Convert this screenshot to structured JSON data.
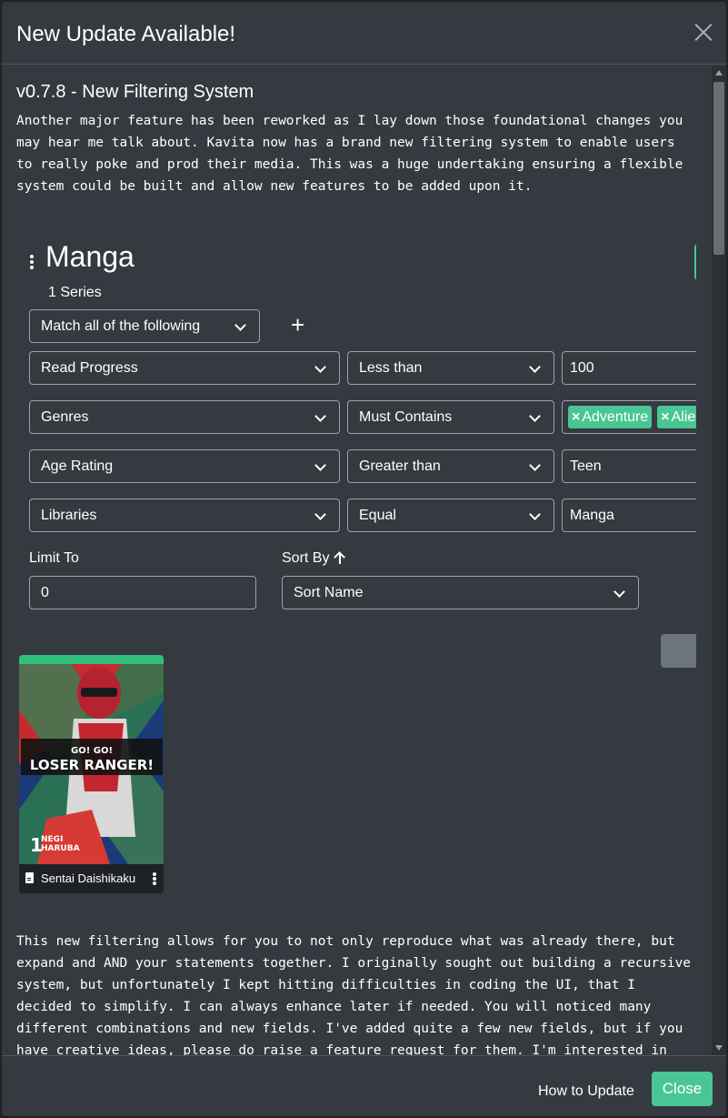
{
  "modal": {
    "title": "New Update Available!",
    "release_title": "v0.7.8 - New Filtering System",
    "intro_text": "Another major feature has been reworked as I lay down those foundational changes you\nmay hear me talk about. Kavita now has a brand new filtering system to enable users\nto really poke and prod their media. This was a huge undertaking ensuring a flexible\nsystem could be built and allow new features to be added upon it.",
    "body_text": "This new filtering allows for you to not only reproduce what was already there, but\nexpand and AND your statements together. I originally sought out building a recursive\nsystem, but unfortunately I kept hitting difficulties in coding the UI, that I\ndecided to simplify. I can always enhance later if needed. You will noticed many\ndifferent combinations and new fields. I've added quite a few new fields, but if you\nhave creative ideas, please do raise a feature request for them. I'm interested in"
  },
  "screenshot": {
    "library_title": "Manga",
    "series_count": "1 Series",
    "match_mode": "Match all of the following",
    "filter_rows": [
      {
        "field": "Read Progress",
        "comparison": "Less than",
        "value": "100"
      },
      {
        "field": "Genres",
        "comparison": "Must Contains",
        "chips": [
          "Adventure",
          "Alie"
        ]
      },
      {
        "field": "Age Rating",
        "comparison": "Greater than",
        "value": "Teen"
      },
      {
        "field": "Libraries",
        "comparison": "Equal",
        "value": "Manga"
      }
    ],
    "limit_to_label": "Limit To",
    "limit_to_value": "0",
    "sort_by_label": "Sort By",
    "sort_by_value": "Sort Name",
    "card": {
      "title": "Sentai Daishikaku",
      "cover_title_line1": "GO! GO!",
      "cover_title_line2": "LOSER RANGER!",
      "cover_author_line1": "NEGI",
      "cover_author_line2": "HARUBA",
      "cover_volume": "1"
    }
  },
  "footer": {
    "how_to_update_label": "How to Update",
    "close_label": "Close"
  },
  "icons": {
    "close": "close-icon",
    "add": "plus-icon",
    "sort_direction": "arrow-up-icon",
    "file": "file-icon",
    "menu": "kebab-icon"
  },
  "colors": {
    "modal_bg": "#343a40",
    "accent_green": "#4ac694",
    "secondary_grey": "#6c757d"
  }
}
